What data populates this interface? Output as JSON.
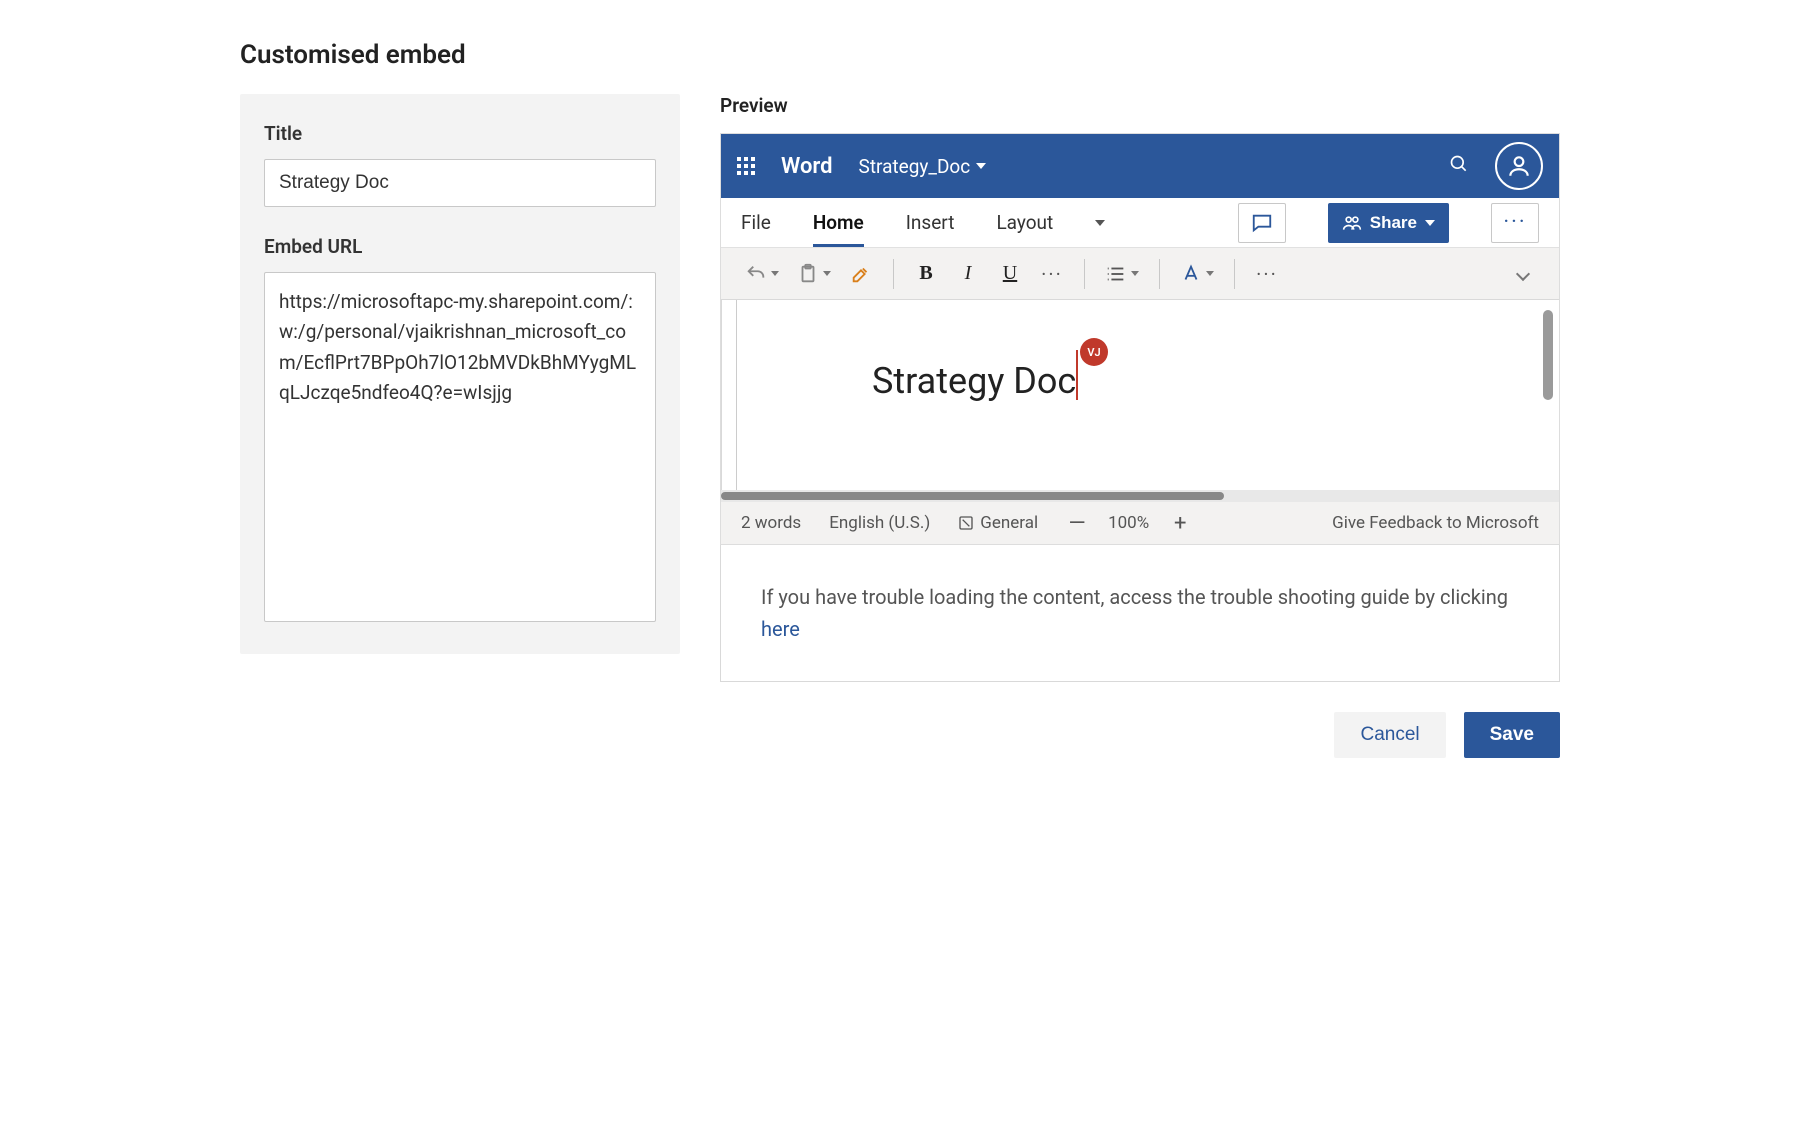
{
  "dialog": {
    "title": "Customised embed"
  },
  "form": {
    "title_label": "Title",
    "title_value": "Strategy Doc",
    "url_label": "Embed URL",
    "url_value": "https://microsoftapc-my.sharepoint.com/:w:/g/personal/vjaikrishnan_microsoft_com/EcflPrt7BPpOh7lO12bMVDkBhMYygMLqLJczqe5ndfeo4Q?e=wIsjjg"
  },
  "preview": {
    "label": "Preview",
    "app_name": "Word",
    "doc_name": "Strategy_Doc",
    "tabs": {
      "file": "File",
      "home": "Home",
      "insert": "Insert",
      "layout": "Layout"
    },
    "share_label": "Share",
    "doc_body_text": "Strategy Doc",
    "presence_initials": "VJ",
    "status": {
      "word_count": "2 words",
      "language": "English (U.S.)",
      "sensitivity": "General",
      "zoom": "100%",
      "feedback": "Give Feedback to Microsoft"
    }
  },
  "trouble": {
    "text_before": "If you have trouble loading the content, access the trouble shooting guide by clicking ",
    "link": "here"
  },
  "footer": {
    "cancel": "Cancel",
    "save": "Save"
  }
}
